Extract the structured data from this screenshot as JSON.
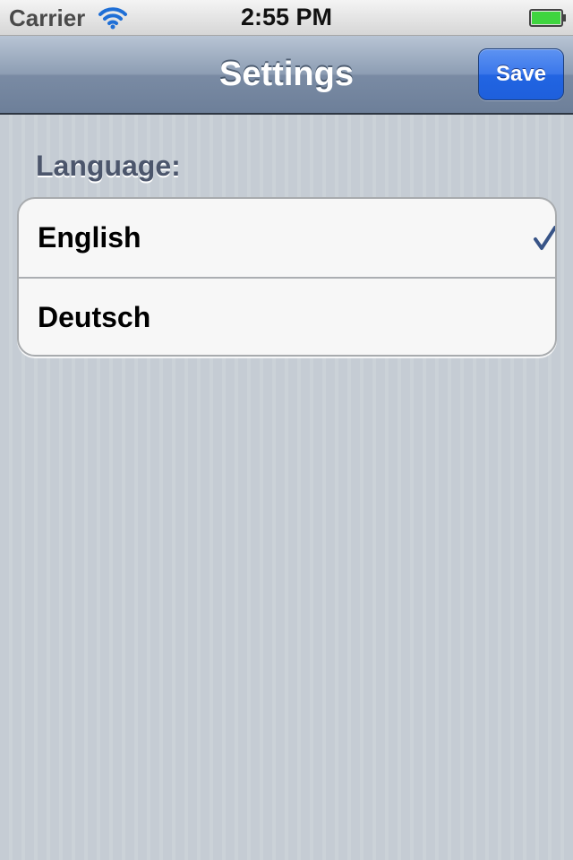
{
  "status_bar": {
    "carrier": "Carrier",
    "time": "2:55 PM",
    "wifi_icon": "wifi-icon",
    "battery_icon": "battery-full-icon",
    "battery_color": "#3fd53f"
  },
  "nav_bar": {
    "title": "Settings",
    "save_label": "Save",
    "save_color": "#2a6ae5"
  },
  "language_section": {
    "header": "Language:",
    "options": [
      {
        "label": "English",
        "selected": true
      },
      {
        "label": "Deutsch",
        "selected": false
      }
    ],
    "checkmark_icon": "checkmark-icon",
    "checkmark_color": "#385487"
  }
}
